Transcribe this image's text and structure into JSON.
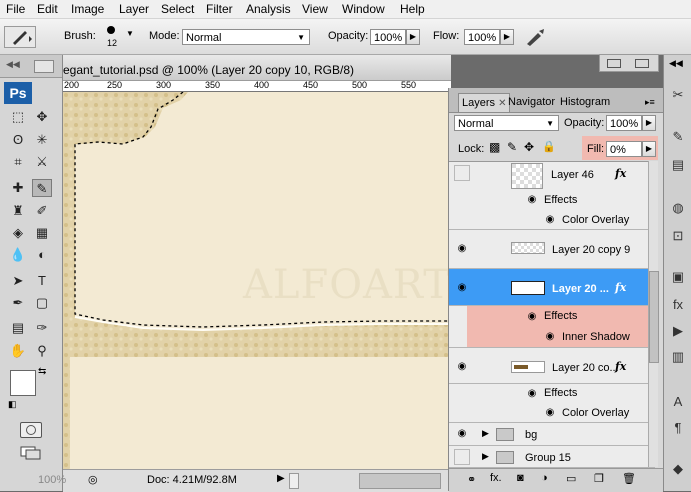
{
  "menu": [
    "File",
    "Edit",
    "Image",
    "Layer",
    "Select",
    "Filter",
    "Analysis",
    "View",
    "Window",
    "Help"
  ],
  "options_bar": {
    "brush_label": "Brush:",
    "brush_size": "12",
    "mode_label": "Mode:",
    "mode_value": "Normal",
    "opacity_label": "Opacity:",
    "opacity_value": "100%",
    "flow_label": "Flow:",
    "flow_value": "100%"
  },
  "tools": {
    "logo": "Ps"
  },
  "document": {
    "title": "egant_tutorial.psd @ 100% (Layer 20 copy 10, RGB/8)",
    "ruler_marks": [
      "200",
      "250",
      "300",
      "350",
      "400",
      "450",
      "500",
      "550"
    ],
    "watermark": "ALFOART",
    "zoom": "100%",
    "doc_size": "Doc: 4.21M/92.8M"
  },
  "layers_panel": {
    "tabs": [
      "Layers",
      "Navigator",
      "Histogram"
    ],
    "blend_mode": "Normal",
    "opacity_label": "Opacity:",
    "opacity_value": "100%",
    "lock_label": "Lock:",
    "fill_label": "Fill:",
    "fill_value": "0%",
    "layers": [
      {
        "name": "Layer 46",
        "visible": false,
        "fx": true
      },
      {
        "name": "Effects"
      },
      {
        "name": "Color Overlay"
      },
      {
        "name": "Layer 20 copy 9",
        "visible": true,
        "fx": false
      },
      {
        "name": "Layer 20 ...",
        "visible": true,
        "fx": true,
        "selected": true
      },
      {
        "name": "Effects"
      },
      {
        "name": "Inner Shadow"
      },
      {
        "name": "Layer 20 co...",
        "visible": true,
        "fx": true
      },
      {
        "name": "Effects"
      },
      {
        "name": "Color Overlay"
      },
      {
        "name": "bg",
        "visible": true,
        "group": true
      },
      {
        "name": "Group 15",
        "visible": false,
        "group": true
      }
    ]
  },
  "colors": {
    "selected_layer": "#3d9bf5",
    "highlight": "#f1b9b0",
    "canvas": "#f3ead3"
  }
}
